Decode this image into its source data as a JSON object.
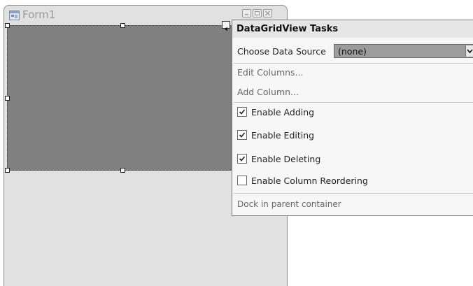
{
  "form": {
    "title": "Form1",
    "buttons": {
      "minimize": "minimize-icon",
      "maximize": "maximize-icon",
      "close": "close-icon"
    }
  },
  "panel": {
    "header": "DataGridView Tasks",
    "choose_label": "Choose Data Source",
    "data_source_value": "(none)",
    "edit_columns": "Edit Columns...",
    "add_column": "Add Column...",
    "checks": [
      {
        "label": "Enable Adding",
        "checked": true
      },
      {
        "label": "Enable Editing",
        "checked": true
      },
      {
        "label": "Enable Deleting",
        "checked": true
      },
      {
        "label": "Enable Column Reordering",
        "checked": false
      }
    ],
    "dock": "Dock in parent container"
  },
  "colors": {
    "grid_background": "#808080",
    "form_background": "#e1e1e1",
    "panel_background": "#f7f7f7"
  }
}
